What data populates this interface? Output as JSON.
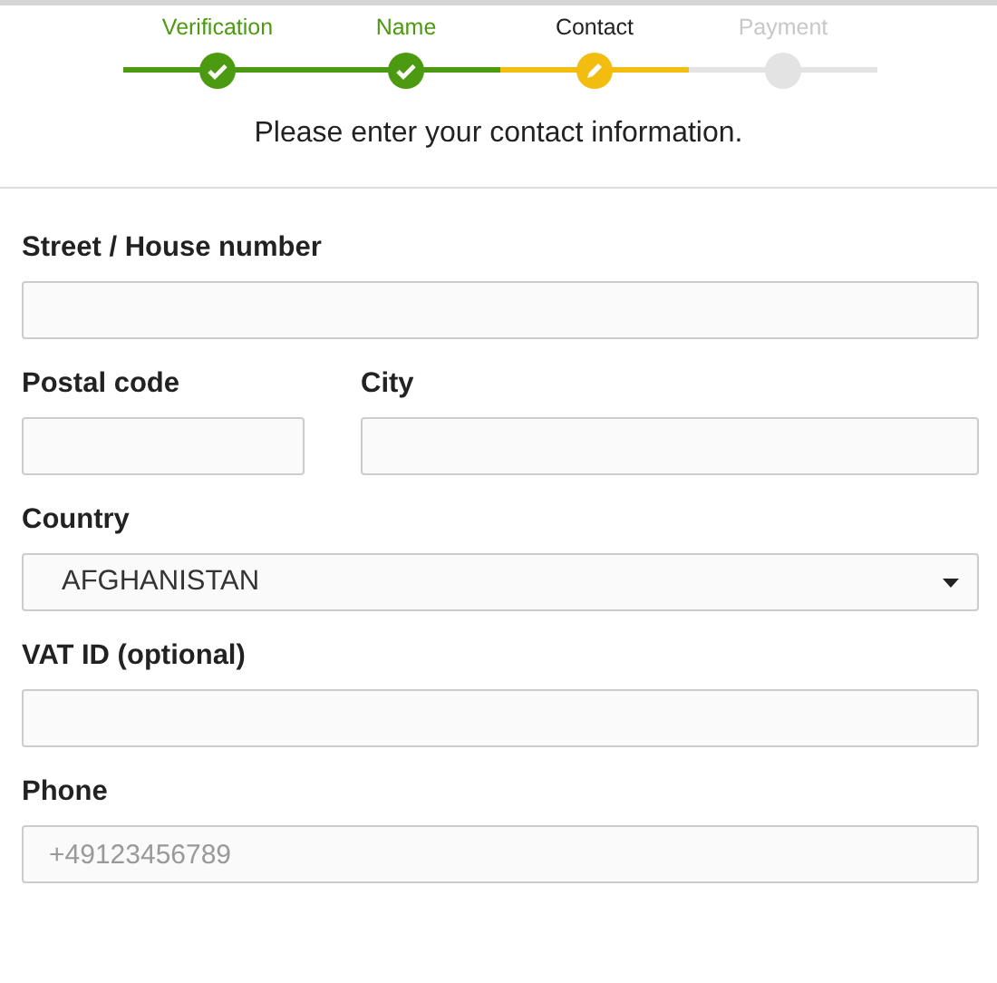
{
  "steps": [
    {
      "label": "Verification",
      "completed": true,
      "selected": false
    },
    {
      "label": "Name",
      "completed": true,
      "selected": false
    },
    {
      "label": "Contact",
      "completed": false,
      "selected": true
    },
    {
      "label": "Payment",
      "completed": false,
      "selected": false
    }
  ],
  "instruction": "Please enter your contact information.",
  "rows": [
    [
      {
        "label": "Street / House number",
        "kind": "text"
      }
    ],
    [
      {
        "label": "Postal code",
        "kind": "text"
      },
      {
        "label": "City",
        "kind": "text"
      }
    ],
    [
      {
        "label": "Country",
        "kind": "select",
        "value": "AFGHANISTAN"
      }
    ],
    [
      {
        "label": "VAT ID (optional)",
        "kind": "text"
      }
    ],
    [
      {
        "label": "Phone",
        "kind": "text",
        "placeholder": "+49123456789"
      }
    ]
  ]
}
